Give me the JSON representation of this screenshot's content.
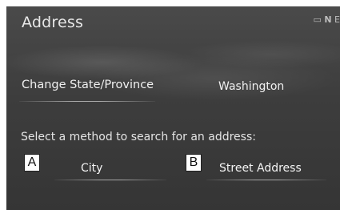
{
  "screen": {
    "title": "Address",
    "status_icons": "▭ 𝗡 E"
  },
  "state_row": {
    "label": "Change State/Province",
    "value": "Washington"
  },
  "search": {
    "prompt": "Select a method to search for an address:",
    "options": [
      {
        "marker": "A",
        "label": "City"
      },
      {
        "marker": "B",
        "label": "Street Address"
      }
    ]
  }
}
